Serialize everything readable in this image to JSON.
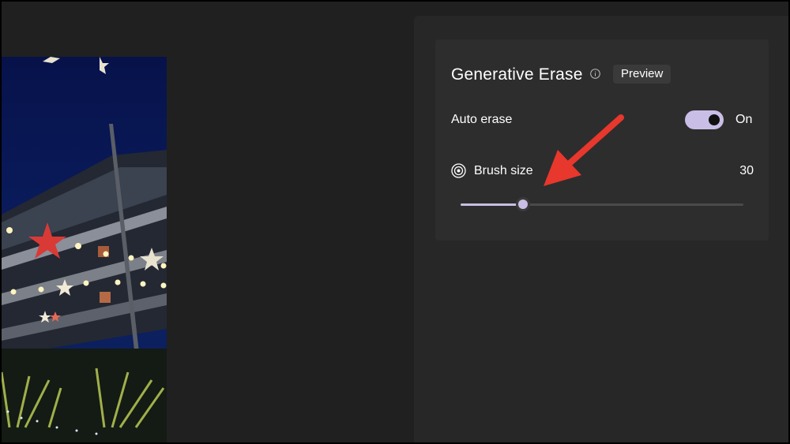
{
  "panel": {
    "title": "Generative Erase",
    "badge": "Preview",
    "auto_erase": {
      "label": "Auto erase",
      "state": "On",
      "enabled": true
    },
    "brush_size": {
      "label": "Brush size",
      "value": "30",
      "fraction": 0.22
    }
  },
  "icons": {
    "info": "info-icon",
    "brush": "concentric-circles-icon",
    "annotation": "red-arrow"
  },
  "colors": {
    "accent": "#c9bee6",
    "annotation": "#e8372c",
    "background": "#202020",
    "panel": "#2d2d2d"
  }
}
